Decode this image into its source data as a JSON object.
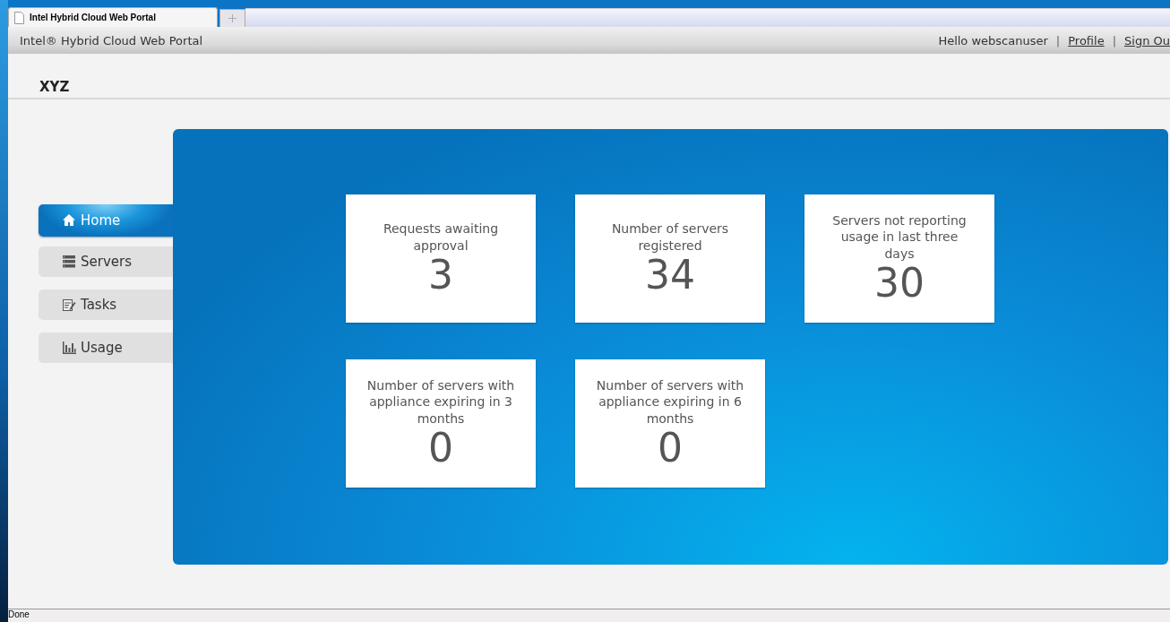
{
  "browser_tab": {
    "title": "Intel Hybrid Cloud Web Portal"
  },
  "header": {
    "title": "Intel® Hybrid Cloud Web Portal",
    "greeting": "Hello webscanuser",
    "separator_1": "|",
    "profile_link": "Profile",
    "separator_2": "|",
    "signout_link": "Sign Ou"
  },
  "page_title": "XYZ",
  "nav": [
    {
      "label": "Home",
      "selected": true
    },
    {
      "label": "Servers",
      "selected": false
    },
    {
      "label": "Tasks",
      "selected": false
    },
    {
      "label": "Usage",
      "selected": false
    }
  ],
  "tiles": [
    {
      "label": "Requests awaiting approval",
      "value": "3"
    },
    {
      "label": "Number of servers registered",
      "value": "34"
    },
    {
      "label": "Servers not reporting usage in last three days",
      "value": "30"
    },
    {
      "label": "Number of servers with appliance expiring in 3 months",
      "value": "0"
    },
    {
      "label": "Number of servers with appliance expiring in 6 months",
      "value": "0"
    }
  ],
  "status_bar": "Done"
}
